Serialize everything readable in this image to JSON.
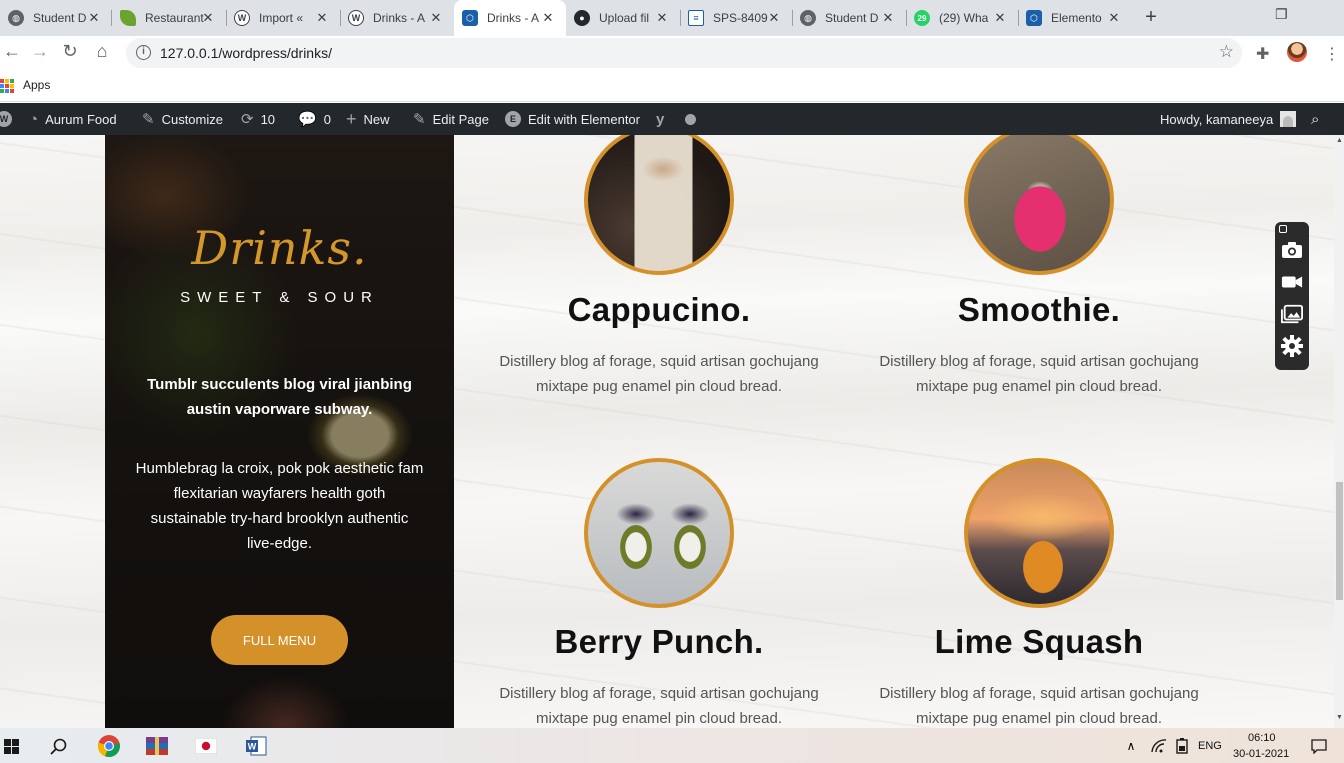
{
  "browser": {
    "tabs": [
      {
        "title": "Student D",
        "icon": "globe-icon",
        "color": "#5f6368"
      },
      {
        "title": "Restaurant",
        "icon": "leaf-icon",
        "color": "#6ca32f"
      },
      {
        "title": "Import «",
        "icon": "wordpress-icon",
        "color": "#3c4043"
      },
      {
        "title": "Drinks - A",
        "icon": "wordpress-icon",
        "color": "#3c4043"
      },
      {
        "title": "Drinks - A",
        "icon": "hexagon-icon",
        "color": "#1a5fa8",
        "active": true
      },
      {
        "title": "Upload fil",
        "icon": "github-icon",
        "color": "#24292e"
      },
      {
        "title": "SPS-8409",
        "icon": "form-icon",
        "color": "#1a5fa8"
      },
      {
        "title": "Student D",
        "icon": "globe-icon",
        "color": "#5f6368"
      },
      {
        "title": "(29) Wha",
        "icon": "whatsapp-icon",
        "color": "#25d366"
      },
      {
        "title": "Elemento",
        "icon": "hexagon-icon",
        "color": "#1a5fa8"
      }
    ],
    "url": "127.0.0.1/wordpress/drinks/",
    "bookmarks_apps": "Apps"
  },
  "adminbar": {
    "site_name": "Aurum Food",
    "customize": "Customize",
    "updates_count": "10",
    "comments_count": "0",
    "new_label": "New",
    "edit_page": "Edit Page",
    "edit_elementor": "Edit with Elementor",
    "howdy": "Howdy, kamaneeya"
  },
  "hero": {
    "title": "Drinks.",
    "subtitle": "SWEET & SOUR",
    "bold_text": "Tumblr succulents blog viral jianbing austin vaporware subway.",
    "body_text": "Humblebrag la croix, pok pok aesthetic fam flexitarian wayfarers health goth sustainable try-hard brooklyn authentic live-edge.",
    "button_label": "FULL MENU",
    "accent_color": "#d4912a"
  },
  "drinks": [
    {
      "name": "Cappucino.",
      "description": "Distillery blog af forage, squid artisan gochujang mixtape pug enamel pin cloud bread."
    },
    {
      "name": "Smoothie.",
      "description": "Distillery blog af forage, squid artisan gochujang mixtape pug enamel pin cloud bread."
    },
    {
      "name": "Berry Punch.",
      "description": "Distillery blog af forage, squid artisan gochujang mixtape pug enamel pin cloud bread."
    },
    {
      "name": "Lime Squash",
      "description": "Distillery blog af forage, squid artisan gochujang mixtape pug enamel pin cloud bread."
    }
  ],
  "taskbar": {
    "language": "ENG",
    "time": "06:10",
    "date": "30-01-2021"
  }
}
